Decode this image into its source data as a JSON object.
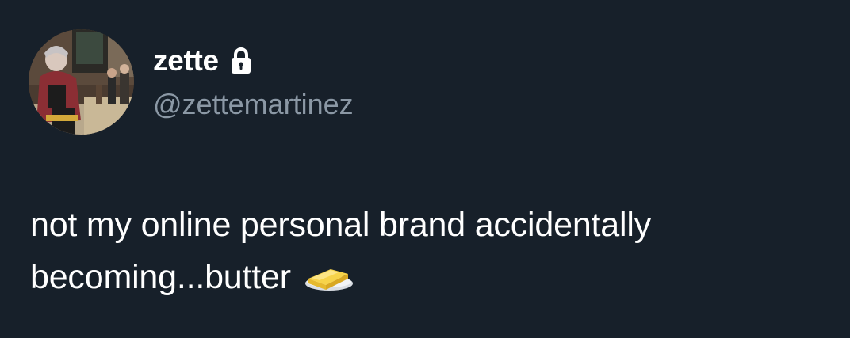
{
  "author": {
    "display_name": "zette",
    "handle": "@zettemartinez",
    "protected_icon": "lock-icon",
    "avatar_icon": "profile-photo"
  },
  "tweet": {
    "line1": "not my online personal brand accidentally",
    "line2": "becoming...butter",
    "emoji": "butter-emoji"
  },
  "colors": {
    "background": "#17202a",
    "text": "#ffffff",
    "handle": "#8b98a5"
  }
}
